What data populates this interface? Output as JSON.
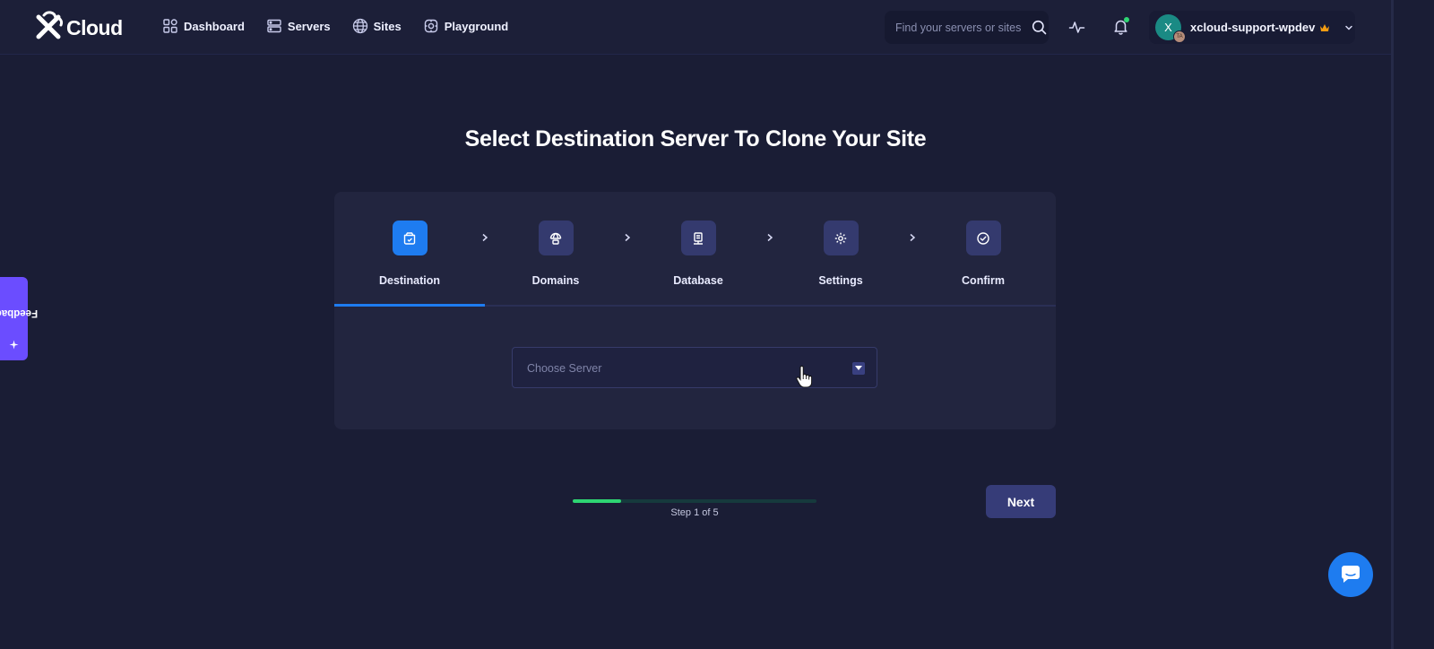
{
  "brand": {
    "name": "Cloud"
  },
  "nav": [
    {
      "label": "Dashboard",
      "icon": "dashboard-icon"
    },
    {
      "label": "Servers",
      "icon": "servers-icon"
    },
    {
      "label": "Sites",
      "icon": "globe-icon"
    },
    {
      "label": "Playground",
      "icon": "playground-icon"
    }
  ],
  "search": {
    "placeholder": "Find your servers or sites"
  },
  "user": {
    "avatar_initial": "X",
    "avatar_badge": "TA",
    "name": "xcloud-support-wpdev"
  },
  "feedback": {
    "label": "Feedback"
  },
  "page": {
    "title": "Select Destination Server To Clone Your Site"
  },
  "steps": [
    {
      "label": "Destination",
      "icon": "destination-icon",
      "active": true
    },
    {
      "label": "Domains",
      "icon": "domains-icon",
      "active": false
    },
    {
      "label": "Database",
      "icon": "database-icon",
      "active": false
    },
    {
      "label": "Settings",
      "icon": "gear-icon",
      "active": false
    },
    {
      "label": "Confirm",
      "icon": "check-circle-icon",
      "active": false
    }
  ],
  "server_select": {
    "placeholder": "Choose Server"
  },
  "progress": {
    "current_step": 1,
    "total_steps": 5,
    "fraction": 0.2,
    "text": "Step 1 of 5"
  },
  "actions": {
    "next_label": "Next"
  },
  "colors": {
    "accent": "#1e7cf0",
    "progress": "#2ed573",
    "feedback": "#6b4dff",
    "background": "#1a1d35"
  }
}
